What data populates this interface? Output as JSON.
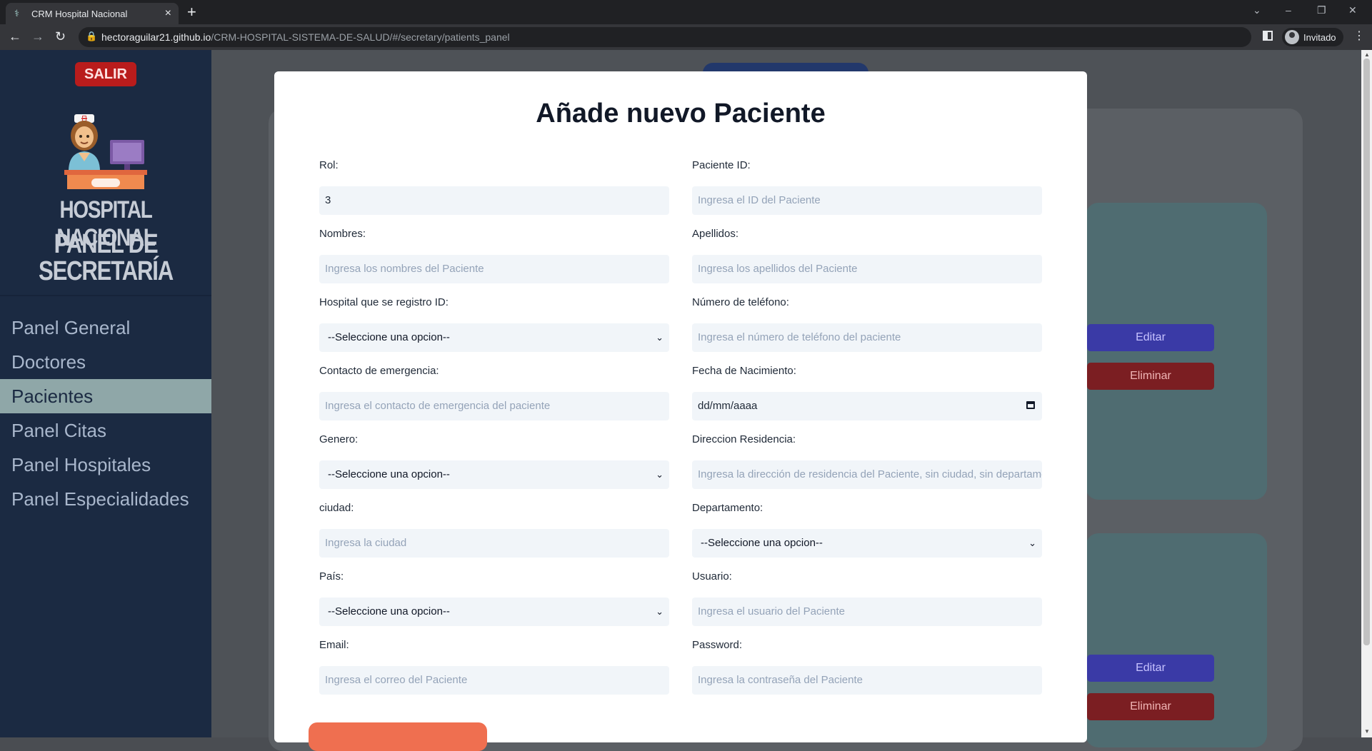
{
  "browser": {
    "tab_title": "CRM Hospital Nacional",
    "url_host": "hectoraguilar21.github.io",
    "url_path": "/CRM-HOSPITAL-SISTEMA-DE-SALUD/#/secretary/patients_panel",
    "profile": "Invitado"
  },
  "sidebar": {
    "logout": "SALIR",
    "brand_line1": "HOSPITAL NACIONAL",
    "brand_line2": "PANEL DE",
    "brand_line3": "SECRETARÍA",
    "items": [
      {
        "label": "Panel General"
      },
      {
        "label": "Doctores"
      },
      {
        "label": "Pacientes",
        "active": true
      },
      {
        "label": "Panel Citas"
      },
      {
        "label": "Panel Hospitales"
      },
      {
        "label": "Panel Especialidades"
      }
    ]
  },
  "background_cards": {
    "edit_label": "Editar",
    "delete_label": "Eliminar"
  },
  "modal": {
    "title": "Añade nuevo Paciente",
    "fields": {
      "rol": {
        "label": "Rol:",
        "value": "3"
      },
      "paciente_id": {
        "label": "Paciente ID:",
        "placeholder": "Ingresa el ID del Paciente"
      },
      "nombres": {
        "label": "Nombres:",
        "placeholder": "Ingresa los nombres del Paciente"
      },
      "apellidos": {
        "label": "Apellidos:",
        "placeholder": "Ingresa los apellidos del Paciente"
      },
      "hospital": {
        "label": "Hospital que se registro ID:",
        "selected": "--Seleccione una opcion--"
      },
      "telefono": {
        "label": "Número de teléfono:",
        "placeholder": "Ingresa el número de teléfono del paciente"
      },
      "emergencia": {
        "label": "Contacto de emergencia:",
        "placeholder": "Ingresa el contacto de emergencia del paciente"
      },
      "nacimiento": {
        "label": "Fecha de Nacimiento:",
        "value": "dd/mm/aaaa"
      },
      "genero": {
        "label": "Genero:",
        "selected": "--Seleccione una opcion--"
      },
      "direccion": {
        "label": "Direccion Residencia:",
        "placeholder": "Ingresa la dirección de residencia del Paciente, sin ciudad, sin departamento"
      },
      "ciudad": {
        "label": "ciudad:",
        "placeholder": "Ingresa la ciudad"
      },
      "departamento": {
        "label": "Departamento:",
        "selected": "--Seleccione una opcion--"
      },
      "pais": {
        "label": "País:",
        "selected": "--Seleccione una opcion--"
      },
      "usuario": {
        "label": "Usuario:",
        "placeholder": "Ingresa el usuario del Paciente"
      },
      "email": {
        "label": "Email:",
        "placeholder": "Ingresa el correo del Paciente"
      },
      "password": {
        "label": "Password:",
        "placeholder": "Ingresa la contraseña del Paciente"
      }
    }
  }
}
